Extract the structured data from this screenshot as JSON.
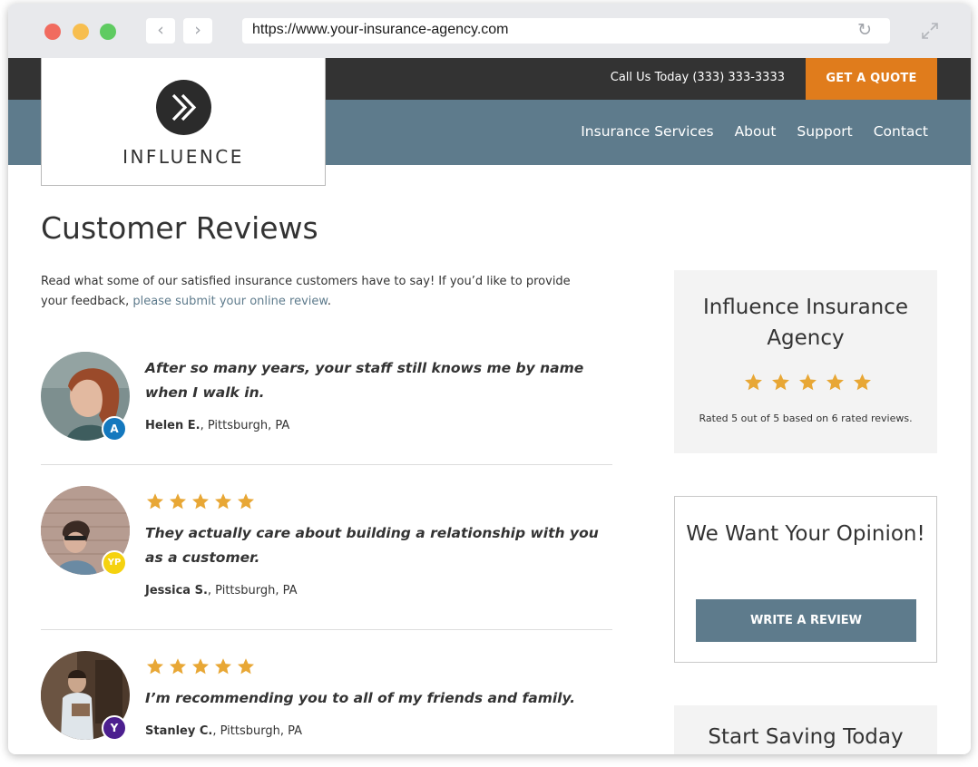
{
  "browser": {
    "url": "https://www.your-insurance-agency.com",
    "back_icon": "chevron-left-icon",
    "forward_icon": "chevron-right-icon",
    "reload_icon": "reload-icon",
    "expand_icon": "expand-icon"
  },
  "topbar": {
    "call_text": "Call Us Today (333) 333-3333",
    "quote_button": "GET A QUOTE",
    "quote_color": "#e07c1c"
  },
  "logo": {
    "name": "INFLUENCE",
    "icon": "double-chevron-icon"
  },
  "nav": {
    "items": [
      "Insurance Services",
      "About",
      "Support",
      "Contact"
    ],
    "background": "#5e7b8c"
  },
  "page": {
    "title": "Customer Reviews",
    "intro_text": "Read what some of our satisfied insurance customers have to say! If you’d like to provide your feedback,",
    "intro_link": "please submit your online review",
    "intro_end": "."
  },
  "reviews": [
    {
      "quote": "After so many years, your staff still knows me by name when I walk in.",
      "name": "Helen E.",
      "location": ", Pittsburgh, PA",
      "source_badge": "A",
      "source_icon": "angies-list-icon",
      "rating": null
    },
    {
      "quote": "They actually care about building a relationship with you as a customer.",
      "name": "Jessica S.",
      "location": ", Pittsburgh, PA",
      "source_badge": "YP",
      "source_icon": "yellow-pages-icon",
      "rating": 5
    },
    {
      "quote": "I’m recommending you to all of my friends and family.",
      "name": "Stanley C.",
      "location": ", Pittsburgh, PA",
      "source_badge": "Y",
      "source_icon": "yahoo-icon",
      "rating": 5
    }
  ],
  "sidebar": {
    "agency_card": {
      "title": "Influence Insurance Agency",
      "rating": 5,
      "rated_text": "Rated 5 out of 5 based on 6 rated reviews."
    },
    "opinion_card": {
      "title": "We Want Your Opinion!",
      "button": "WRITE A REVIEW"
    },
    "saving_card": {
      "title": "Start Saving Today"
    }
  },
  "colors": {
    "star": "#e8a735",
    "link": "#5e7b8c",
    "dark_bar": "#333333"
  }
}
